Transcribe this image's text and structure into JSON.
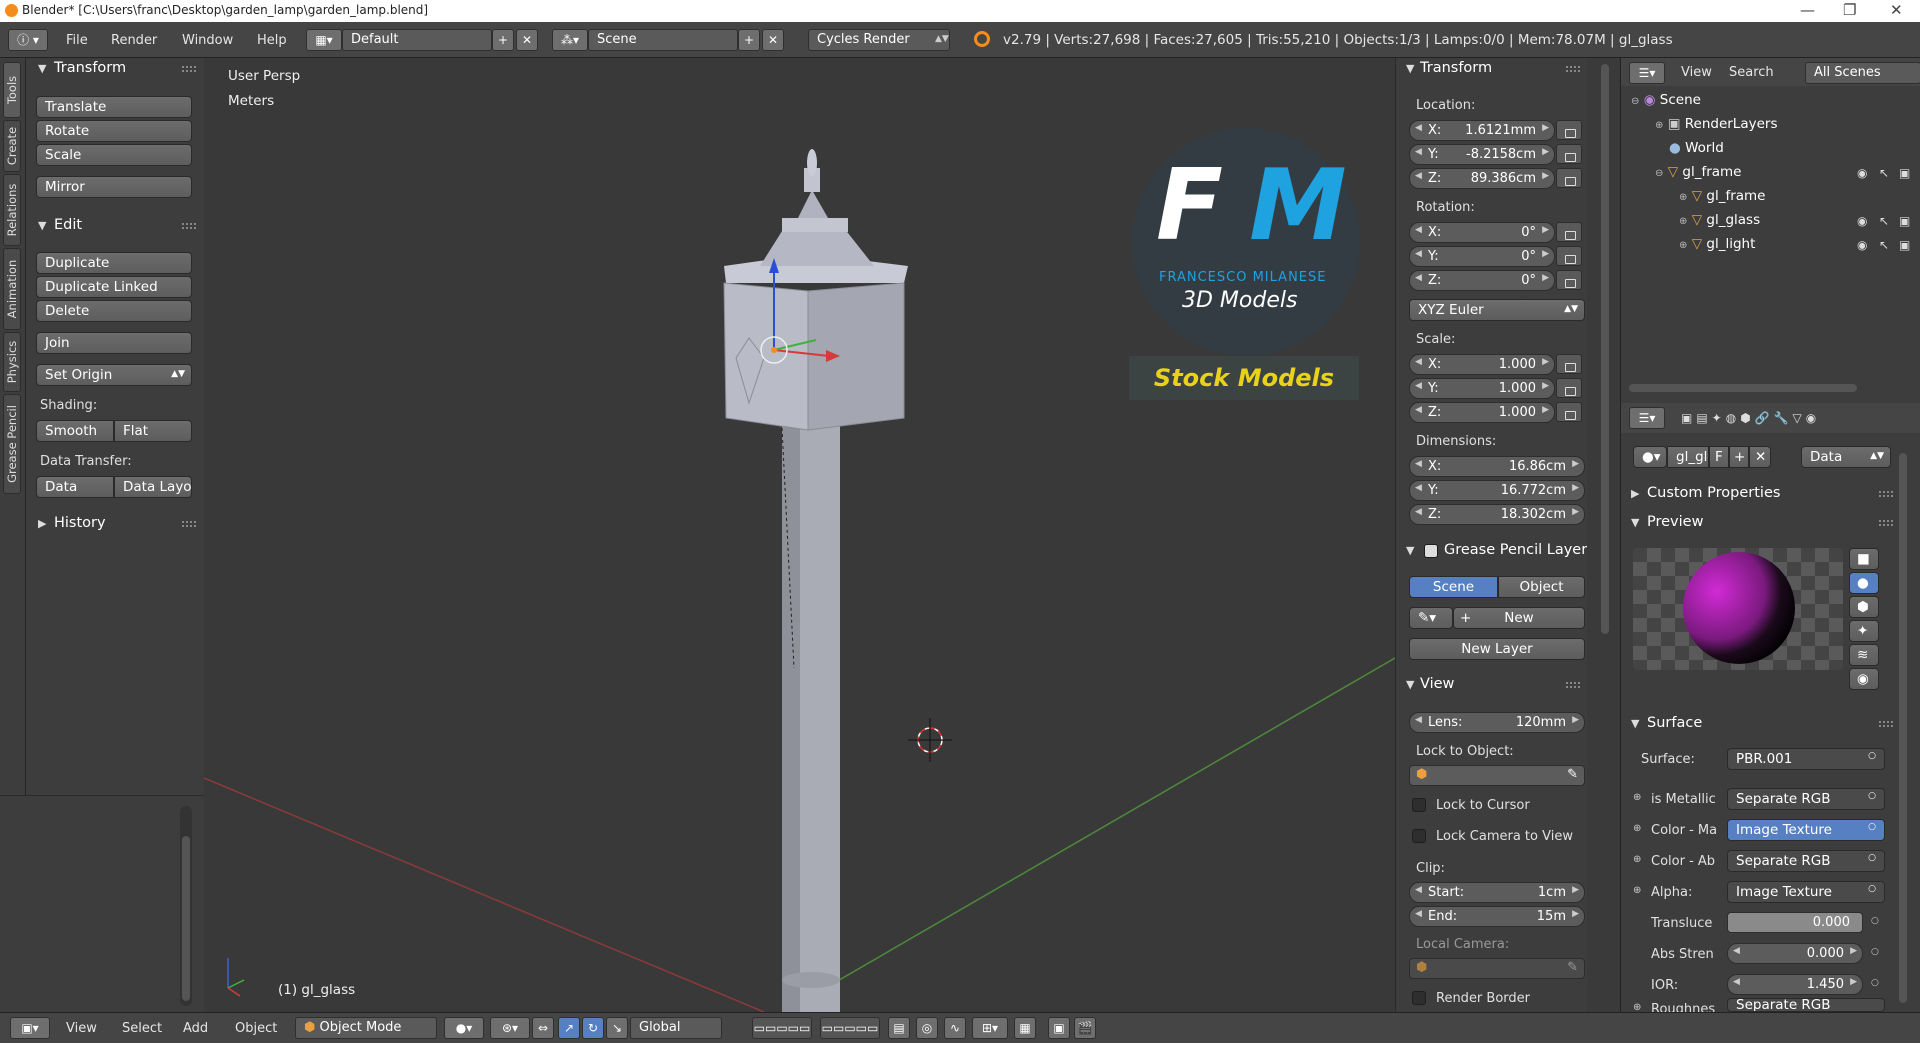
{
  "window": {
    "title": "Blender* [C:\\Users\\franc\\Desktop\\garden_lamp\\garden_lamp.blend]",
    "controls": [
      "—",
      "❐",
      "✕"
    ]
  },
  "header": {
    "menus": [
      "File",
      "Render",
      "Window",
      "Help"
    ],
    "screen_layout": "Default",
    "scene": "Scene",
    "engine": "Cycles Render",
    "stats": "v2.79 | Verts:27,698 | Faces:27,605 | Tris:55,210 | Objects:1/3 | Lamps:0/0 | Mem:78.07M | gl_glass"
  },
  "left_tabs": [
    "Tools",
    "Create",
    "Relations",
    "Animation",
    "Physics",
    "Grease Pencil"
  ],
  "toolshelf": {
    "transform": {
      "title": "Transform",
      "buttons": [
        "Translate",
        "Rotate",
        "Scale",
        "Mirror"
      ]
    },
    "edit": {
      "title": "Edit",
      "buttons": [
        "Duplicate",
        "Duplicate Linked",
        "Delete",
        "Join"
      ],
      "set_origin": "Set Origin",
      "shading_label": "Shading:",
      "shading": [
        "Smooth",
        "Flat"
      ],
      "data_transfer_label": "Data Transfer:",
      "data_transfer": [
        "Data",
        "Data Layo"
      ]
    },
    "history": {
      "title": "History"
    }
  },
  "viewport": {
    "view_name": "User Persp",
    "units": "Meters",
    "object_label": "(1) gl_glass",
    "logo": {
      "initials": "FM",
      "company": "FRANCESCO MILANESE",
      "sub": "3D Models",
      "stock": "Stock Models"
    },
    "colors": {
      "grid": "#393939",
      "x_axis": "#8b3a3a",
      "y_axis": "#4d8a3a",
      "logo_blue": "#1ea2e0",
      "stock_yellow": "#e8d21a"
    }
  },
  "npanel": {
    "transform_title": "Transform",
    "location_label": "Location:",
    "location": [
      {
        "k": "X:",
        "v": "1.6121mm"
      },
      {
        "k": "Y:",
        "v": "-8.2158cm"
      },
      {
        "k": "Z:",
        "v": "89.386cm"
      }
    ],
    "rotation_label": "Rotation:",
    "rotation": [
      {
        "k": "X:",
        "v": "0°"
      },
      {
        "k": "Y:",
        "v": "0°"
      },
      {
        "k": "Z:",
        "v": "0°"
      }
    ],
    "rotation_mode": "XYZ Euler",
    "scale_label": "Scale:",
    "scale": [
      {
        "k": "X:",
        "v": "1.000"
      },
      {
        "k": "Y:",
        "v": "1.000"
      },
      {
        "k": "Z:",
        "v": "1.000"
      }
    ],
    "dimensions_label": "Dimensions:",
    "dimensions": [
      {
        "k": "X:",
        "v": "16.86cm"
      },
      {
        "k": "Y:",
        "v": "16.772cm"
      },
      {
        "k": "Z:",
        "v": "18.302cm"
      }
    ],
    "grease_title": "Grease Pencil Layer",
    "grease_tabs": [
      "Scene",
      "Object"
    ],
    "grease_new": "New",
    "grease_new_layer": "New Layer",
    "view_title": "View",
    "lens_label": "Lens:",
    "lens": "120mm",
    "lock_obj_label": "Lock to Object:",
    "lock_cursor": "Lock to Cursor",
    "lock_camera": "Lock Camera to View",
    "clip_label": "Clip:",
    "clip_start_label": "Start:",
    "clip_start": "1cm",
    "clip_end_label": "End:",
    "clip_end": "15m",
    "local_camera_label": "Local Camera:",
    "render_border": "Render Border"
  },
  "outliner": {
    "tabs": [
      "View",
      "Search",
      "All Scenes"
    ],
    "items": [
      {
        "name": "Scene",
        "indent": 0
      },
      {
        "name": "RenderLayers",
        "indent": 1
      },
      {
        "name": "World",
        "indent": 1
      },
      {
        "name": "gl_frame",
        "indent": 1
      },
      {
        "name": "gl_frame",
        "indent": 2
      },
      {
        "name": "gl_glass",
        "indent": 2
      },
      {
        "name": "gl_light",
        "indent": 2
      }
    ]
  },
  "properties": {
    "material_name": "gl_gla",
    "f_label": "F",
    "data_combo": "Data",
    "custom_props": "Custom Properties",
    "preview_title": "Preview",
    "surface_title": "Surface",
    "rows": [
      {
        "label": "Surface:",
        "value": "PBR.001"
      },
      {
        "label": "is Metallic",
        "value": "Separate RGB"
      },
      {
        "label": "Color - Ma",
        "value": "Image Texture"
      },
      {
        "label": "Color - Ab",
        "value": "Separate RGB"
      },
      {
        "label": "Alpha:",
        "value": "Image Texture"
      },
      {
        "label": "Transluce",
        "value": "0.000"
      },
      {
        "label": "Abs Stren",
        "value": "0.000"
      },
      {
        "label": "IOR:",
        "value": "1.450"
      },
      {
        "label": "Roughnes",
        "value": "Separate RGB"
      }
    ]
  },
  "footer": {
    "menus": [
      "View",
      "Select",
      "Add",
      "Object"
    ],
    "mode": "Object Mode",
    "orientation": "Global"
  }
}
